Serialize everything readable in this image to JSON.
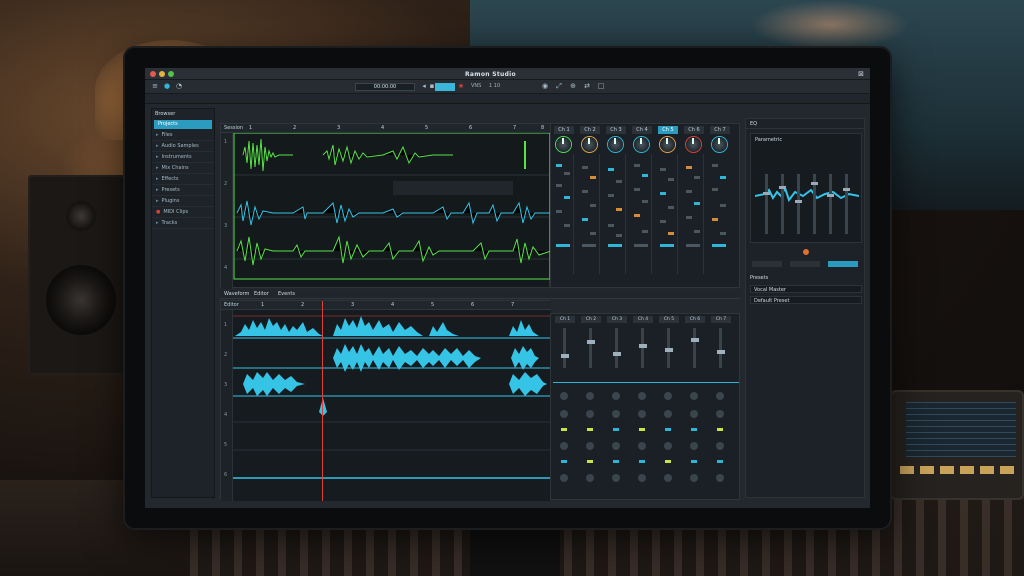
{
  "app": {
    "title": "Ramon Studio",
    "toolbar": {
      "left_items": [
        "≡",
        "●",
        "◔"
      ],
      "transport_text": "00:00:00",
      "counter": "VNS",
      "position": "1 10",
      "right_icons": [
        "◉",
        "⤢",
        "⊕",
        "⇄",
        "□"
      ]
    },
    "sidebar": {
      "header": "Browser",
      "selected": "Projects",
      "items": [
        "Files",
        "Audio Samples",
        "Instruments",
        "Mix Chains",
        "Effects",
        "Presets",
        "Plugins",
        "MIDI Clips",
        "Tracks"
      ]
    },
    "arrange": {
      "header": "Session",
      "ruler_marks": [
        "1",
        "2",
        "3",
        "4",
        "5",
        "6",
        "7",
        "8"
      ],
      "gutter_labels": [
        "1",
        "2",
        "3",
        "4"
      ]
    },
    "mixer_top": {
      "channels": [
        "Ch 1",
        "Ch 2",
        "Ch 3",
        "Ch 4",
        "Ch 5",
        "Ch 6",
        "Ch 7"
      ],
      "active_channel_index": 4,
      "knob_colors": [
        "#4fdc5a",
        "#e0a24a",
        "#2fb5d6",
        "#2fb5d6",
        "#e0a24a",
        "#d9413a",
        "#2fb5d6"
      ]
    },
    "editor": {
      "tabs": [
        "Waveform",
        "Editor",
        "Events"
      ],
      "header": "Editor",
      "ruler_marks": [
        "1",
        "2",
        "3",
        "4",
        "5",
        "6",
        "7"
      ],
      "gutter_labels": [
        "1",
        "2",
        "3",
        "4",
        "5",
        "6"
      ]
    },
    "mixer_bottom": {
      "channels": [
        "Ch 1",
        "Ch 2",
        "Ch 3",
        "Ch 4",
        "Ch 5",
        "Ch 6",
        "Ch 7"
      ]
    },
    "right_panel": {
      "header": "EQ",
      "subheader": "Parametric",
      "section": "Presets",
      "row1": "Vocal Master",
      "row2": "Default Preset"
    },
    "colors": {
      "accent": "#2b9cbf",
      "green_wave": "#59e34a",
      "cyan_wave": "#35c4e6",
      "playhead": "#d9413a"
    }
  }
}
